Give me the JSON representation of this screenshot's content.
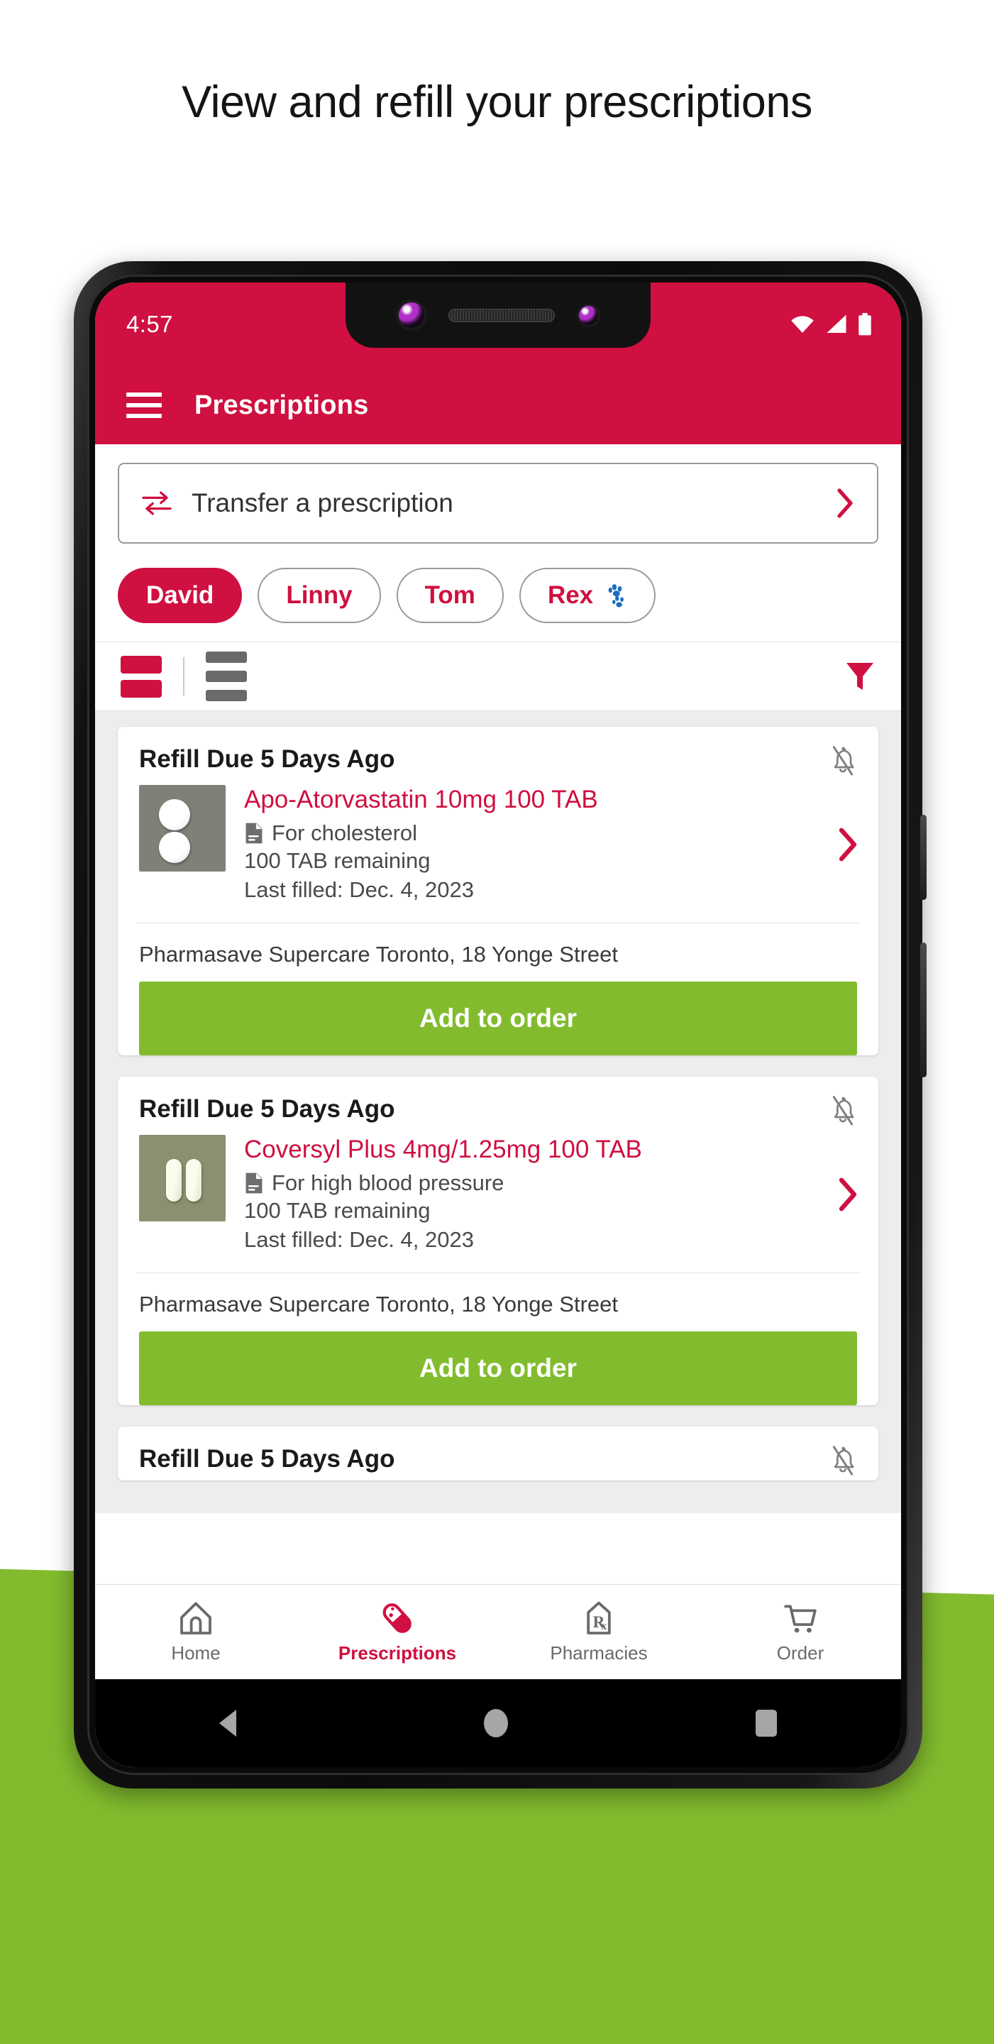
{
  "headline": "View and refill your prescriptions",
  "colors": {
    "brand_crimson": "#cf1040",
    "accent_green": "#82bc2e",
    "paw_blue": "#1b6ec2",
    "text_dark": "#1a1a1a",
    "text_muted": "#4a4a4a",
    "screen_bg": "#eceded"
  },
  "status_bar": {
    "time": "4:57",
    "icons": [
      "wifi-icon",
      "cellular-signal-icon",
      "battery-icon"
    ]
  },
  "app_bar": {
    "menu_icon": "hamburger-menu-icon",
    "title": "Prescriptions"
  },
  "transfer": {
    "icon": "transfer-arrows-icon",
    "label": "Transfer a prescription",
    "chevron": "chevron-right-icon"
  },
  "patients": [
    {
      "name": "David",
      "active": true,
      "has_paw": false
    },
    {
      "name": "Linny",
      "active": false,
      "has_paw": false
    },
    {
      "name": "Tom",
      "active": false,
      "has_paw": false
    },
    {
      "name": "Rex",
      "active": false,
      "has_paw": true
    }
  ],
  "toolbar": {
    "card_view_icon": "card-view-icon",
    "list_view_icon": "list-view-icon",
    "filter_icon": "filter-funnel-icon",
    "card_view_active": true
  },
  "prescriptions": [
    {
      "status": "Refill Due 5 Days Ago",
      "bell_icon": "bell-off-icon",
      "image": "two-round-white-tablets",
      "name": "Apo-Atorvastatin 10mg 100 TAB",
      "doc_icon": "document-icon",
      "indication": "For cholesterol",
      "remaining": "100 TAB remaining",
      "last_filled": "Last filled: Dec. 4, 2023",
      "chevron": "chevron-right-icon",
      "pharmacy": "Pharmasave Supercare Toronto, 18 Yonge Street",
      "action_label": "Add to order"
    },
    {
      "status": "Refill Due 5 Days Ago",
      "bell_icon": "bell-off-icon",
      "image": "two-oblong-white-tablets",
      "name": "Coversyl Plus 4mg/1.25mg 100 TAB",
      "doc_icon": "document-icon",
      "indication": "For high blood pressure",
      "remaining": "100 TAB remaining",
      "last_filled": "Last filled: Dec. 4, 2023",
      "chevron": "chevron-right-icon",
      "pharmacy": "Pharmasave Supercare Toronto, 18 Yonge Street",
      "action_label": "Add to order"
    },
    {
      "status": "Refill Due 5 Days Ago",
      "bell_icon": "bell-off-icon"
    }
  ],
  "bottom_nav": [
    {
      "label": "Home",
      "icon": "home-icon",
      "active": false
    },
    {
      "label": "Prescriptions",
      "icon": "capsule-pill-icon",
      "active": true
    },
    {
      "label": "Pharmacies",
      "icon": "rx-shield-icon",
      "active": false
    },
    {
      "label": "Order",
      "icon": "shopping-cart-icon",
      "active": false
    }
  ],
  "android_nav": [
    {
      "name": "back-button",
      "icon": "triangle-back-icon"
    },
    {
      "name": "home-button",
      "icon": "circle-home-icon"
    },
    {
      "name": "recents-button",
      "icon": "square-recents-icon"
    }
  ]
}
